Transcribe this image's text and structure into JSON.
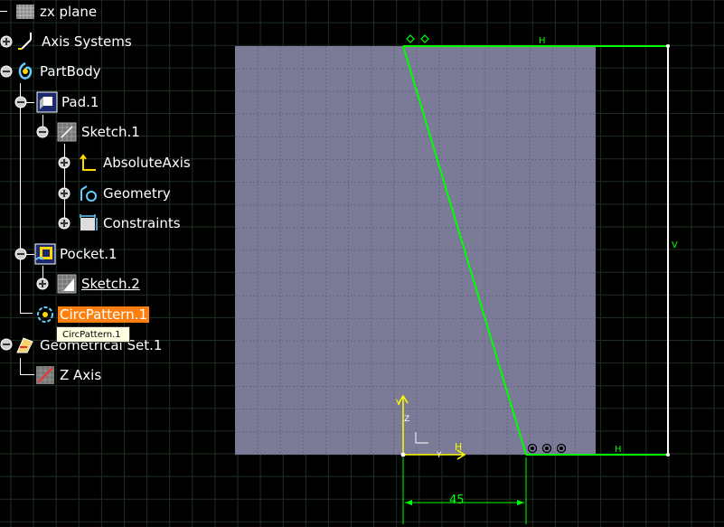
{
  "tree": {
    "items": [
      {
        "label": "zx plane",
        "icon": "plane-icon"
      },
      {
        "label": "Axis Systems",
        "icon": "axis-systems-icon"
      },
      {
        "label": "PartBody",
        "icon": "partbody-icon"
      },
      {
        "label": "Pad.1",
        "icon": "pad-icon"
      },
      {
        "label": "Sketch.1",
        "icon": "sketch-icon"
      },
      {
        "label": "AbsoluteAxis",
        "icon": "absolute-axis-icon"
      },
      {
        "label": "Geometry",
        "icon": "geometry-icon"
      },
      {
        "label": "Constraints",
        "icon": "constraints-icon"
      },
      {
        "label": "Pocket.1",
        "icon": "pocket-icon"
      },
      {
        "label": "Sketch.2",
        "icon": "sketch-icon"
      },
      {
        "label": "CircPattern.1",
        "icon": "circpattern-icon"
      },
      {
        "label": "Geometrical Set.1",
        "icon": "geometrical-set-icon"
      },
      {
        "label": "Z Axis",
        "icon": "z-axis-icon"
      }
    ],
    "tooltip": "CircPattern.1"
  },
  "sketch": {
    "dimension_value": "45",
    "constraint_h": "H",
    "constraint_v": "V",
    "axis_z": "Z",
    "axis_y": "Y",
    "axis_h": "H",
    "axis_v": "V"
  },
  "colors": {
    "sketch_plane": "#7b7b97",
    "profile_line": "#00ff00",
    "axis_yellow": "#ffff00",
    "selection": "#ff7f0e",
    "dimension": "#00ff00"
  }
}
